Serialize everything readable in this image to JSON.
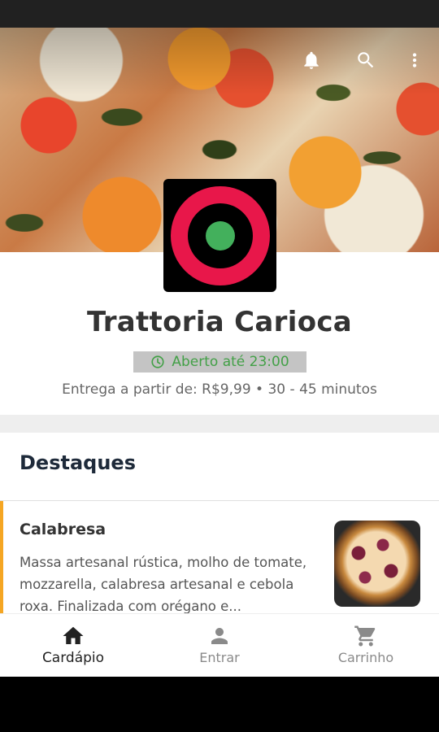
{
  "header": {
    "icons": [
      "bell-icon",
      "search-icon",
      "more-vert-icon"
    ]
  },
  "store": {
    "name": "Trattoria Carioca",
    "status": "Aberto até 23:00",
    "delivery_info": "Entrega a partir de: R$9,99 • 30 - 45 minutos"
  },
  "colors": {
    "logo_ring": "#e8174a",
    "logo_dot": "#43b05c",
    "open_status": "#43a047",
    "accent": "#f5a623"
  },
  "section": {
    "title": "Destaques"
  },
  "products": [
    {
      "name": "Calabresa",
      "description": "Massa artesanal rústica, molho de tomate, mozzarella, calabresa artesanal e cebola roxa. Finalizada com orégano e..."
    }
  ],
  "bottom_nav": {
    "items": [
      {
        "label": "Cardápio",
        "icon": "home-icon",
        "active": true
      },
      {
        "label": "Entrar",
        "icon": "person-icon",
        "active": false
      },
      {
        "label": "Carrinho",
        "icon": "cart-icon",
        "active": false
      }
    ]
  }
}
